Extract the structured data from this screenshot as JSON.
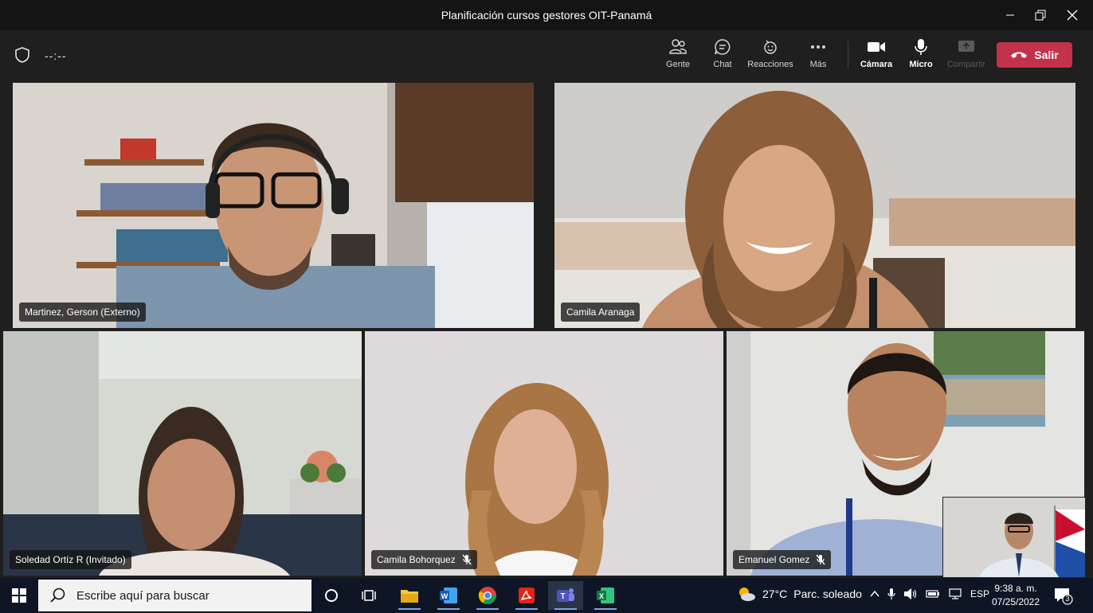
{
  "window": {
    "title": "Planificación cursos gestores OIT-Panamá"
  },
  "toolbar": {
    "timer": "--:--",
    "buttons": [
      {
        "label": "Gente",
        "icon": "people-icon"
      },
      {
        "label": "Chat",
        "icon": "chat-icon"
      },
      {
        "label": "Reacciones",
        "icon": "reactions-icon"
      },
      {
        "label": "Más",
        "icon": "more-icon"
      },
      {
        "label": "Cámara",
        "icon": "camera-icon"
      },
      {
        "label": "Micro",
        "icon": "microphone-icon"
      },
      {
        "label": "Compartir",
        "icon": "share-icon"
      }
    ],
    "leave_label": "Salir",
    "leave_color": "#c4314b"
  },
  "participants": [
    {
      "name": "Martinez, Gerson (Externo)",
      "muted": false
    },
    {
      "name": "Camila Aranaga",
      "muted": false
    },
    {
      "name": "Soledad Ortíz R (Invitado)",
      "muted": false
    },
    {
      "name": "Camila Bohorquez",
      "muted": true
    },
    {
      "name": "Emanuel Gomez",
      "muted": true
    }
  ],
  "taskbar": {
    "search_placeholder": "Escribe aquí para buscar",
    "apps": [
      "task-view-icon",
      "file-explorer-icon",
      "word-icon",
      "chrome-icon",
      "acrobat-icon",
      "teams-icon",
      "excel-icon"
    ],
    "weather_temp": "27°C",
    "weather_desc": "Parc. soleado",
    "language": "ESP",
    "time": "9:38 a. m.",
    "date": "07/25/2022",
    "notifications": "3"
  }
}
